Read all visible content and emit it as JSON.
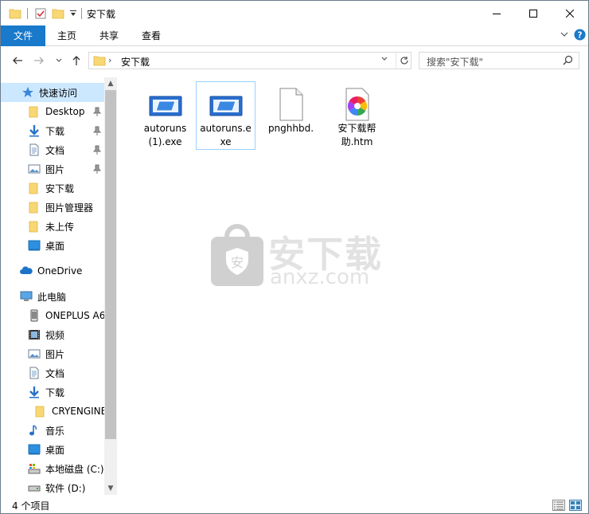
{
  "window": {
    "title": "安下载",
    "minimize_icon": "minimize-icon",
    "maximize_icon": "maximize-icon",
    "close_icon": "close-icon"
  },
  "ribbon": {
    "tabs": [
      {
        "label": "文件",
        "active": true
      },
      {
        "label": "主页"
      },
      {
        "label": "共享"
      },
      {
        "label": "查看"
      }
    ],
    "accent": "#1979ca"
  },
  "address": {
    "path": "安下载",
    "search_placeholder": "搜索\"安下载\""
  },
  "sidebar": {
    "quick_access": "快速访问",
    "quick_items": [
      {
        "label": "Desktop",
        "icon": "folder-icon",
        "pinned": true
      },
      {
        "label": "下载",
        "icon": "download-icon",
        "pinned": true
      },
      {
        "label": "文档",
        "icon": "document-icon",
        "pinned": true
      },
      {
        "label": "图片",
        "icon": "picture-icon",
        "pinned": true
      },
      {
        "label": "安下载",
        "icon": "folder-icon"
      },
      {
        "label": "图片管理器",
        "icon": "folder-icon"
      },
      {
        "label": "未上传",
        "icon": "folder-icon"
      },
      {
        "label": "桌面",
        "icon": "desktop-icon"
      }
    ],
    "onedrive": "OneDrive",
    "this_pc": "此电脑",
    "pc_items": [
      {
        "label": "ONEPLUS A6",
        "icon": "phone-icon"
      },
      {
        "label": "视频",
        "icon": "video-icon"
      },
      {
        "label": "图片",
        "icon": "picture-icon"
      },
      {
        "label": "文档",
        "icon": "document-icon"
      },
      {
        "label": "下载",
        "icon": "download-icon"
      },
      {
        "label": "CRYENGINE",
        "icon": "folder-icon"
      },
      {
        "label": "音乐",
        "icon": "music-icon"
      },
      {
        "label": "桌面",
        "icon": "desktop-icon"
      },
      {
        "label": "本地磁盘 (C:)",
        "icon": "drive-c-icon"
      },
      {
        "label": "软件 (D:)",
        "icon": "drive-icon"
      }
    ]
  },
  "files": [
    {
      "name": "autoruns(1).exe",
      "line1": "autoruns",
      "line2": "(1).exe",
      "icon": "exe-icon",
      "selected": false
    },
    {
      "name": "autoruns.exe",
      "line1": "autoruns.e",
      "line2": "xe",
      "icon": "exe-icon",
      "selected": true
    },
    {
      "name": "pnghhbd.",
      "line1": "pnghhbd.",
      "line2": "",
      "icon": "blank-file-icon",
      "selected": false
    },
    {
      "name": "安下载帮助.htm",
      "line1": "安下载帮",
      "line2": "助.htm",
      "icon": "htm-file-icon",
      "selected": false
    }
  ],
  "watermark": {
    "text": "安下载",
    "sub": "anxz.com"
  },
  "status": {
    "count": "4 个项目"
  }
}
